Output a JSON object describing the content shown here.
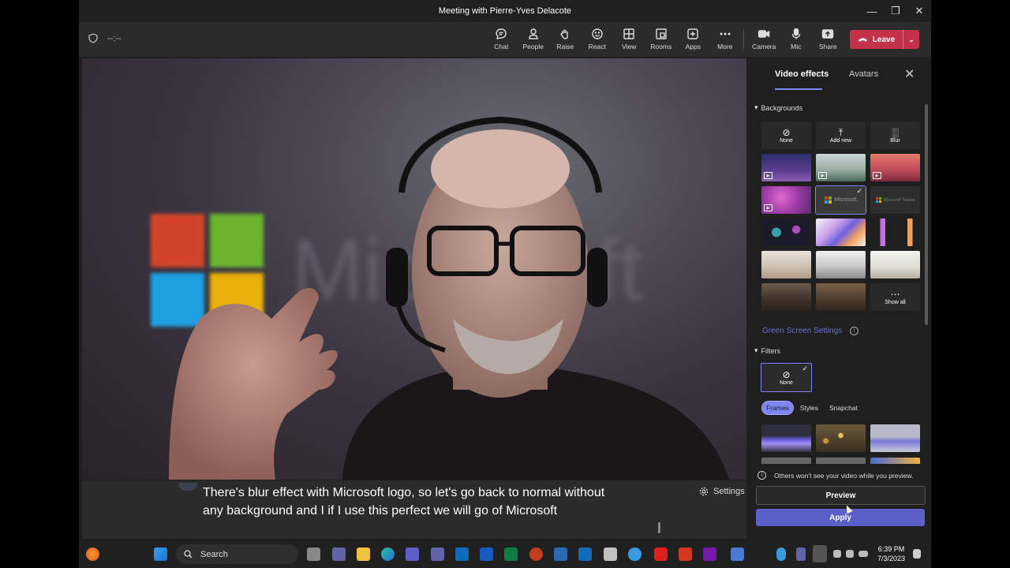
{
  "window": {
    "title": "Meeting with Pierre-Yves Delacote"
  },
  "toolbar": {
    "timer": "--:--",
    "buttons": [
      {
        "label": "Chat",
        "icon": "chat-icon"
      },
      {
        "label": "People",
        "icon": "people-icon"
      },
      {
        "label": "Raise",
        "icon": "hand-icon"
      },
      {
        "label": "React",
        "icon": "smiley-icon"
      },
      {
        "label": "View",
        "icon": "grid-icon"
      },
      {
        "label": "Rooms",
        "icon": "rooms-icon"
      },
      {
        "label": "Apps",
        "icon": "plus-icon"
      },
      {
        "label": "More",
        "icon": "more-icon"
      }
    ],
    "media": [
      {
        "label": "Camera",
        "icon": "camera-icon"
      },
      {
        "label": "Mic",
        "icon": "mic-icon"
      },
      {
        "label": "Share",
        "icon": "share-icon"
      }
    ],
    "leave_label": "Leave"
  },
  "caption": {
    "text": "There's blur effect with Microsoft logo, so let's go back to normal without any background and I if I use this perfect we will go of Microsoft",
    "settings_label": "Settings"
  },
  "panel": {
    "tabs": [
      "Video effects",
      "Avatars"
    ],
    "backgrounds_label": "Backgrounds",
    "tiles": {
      "none": "None",
      "add_new": "Add new",
      "blur": "Blur",
      "show_all": "Show all"
    },
    "tile_logo_text": {
      "microsoft": "Microsoft",
      "microsoft_teams": "Microsoft Teams"
    },
    "green_screen_label": "Green Screen Settings",
    "filters_label": "Filters",
    "filter_none": "None",
    "filter_chips": [
      "Frames",
      "Styles",
      "Snapchat"
    ],
    "notice": "Others won't see your video while you preview.",
    "preview_label": "Preview",
    "apply_label": "Apply"
  },
  "taskbar": {
    "search_label": "Search",
    "time": "6:39 PM",
    "date": "7/3/2023"
  },
  "colors": {
    "accent": "#7f85f5",
    "leave": "#c4314b",
    "apply": "#5b5fc7"
  }
}
